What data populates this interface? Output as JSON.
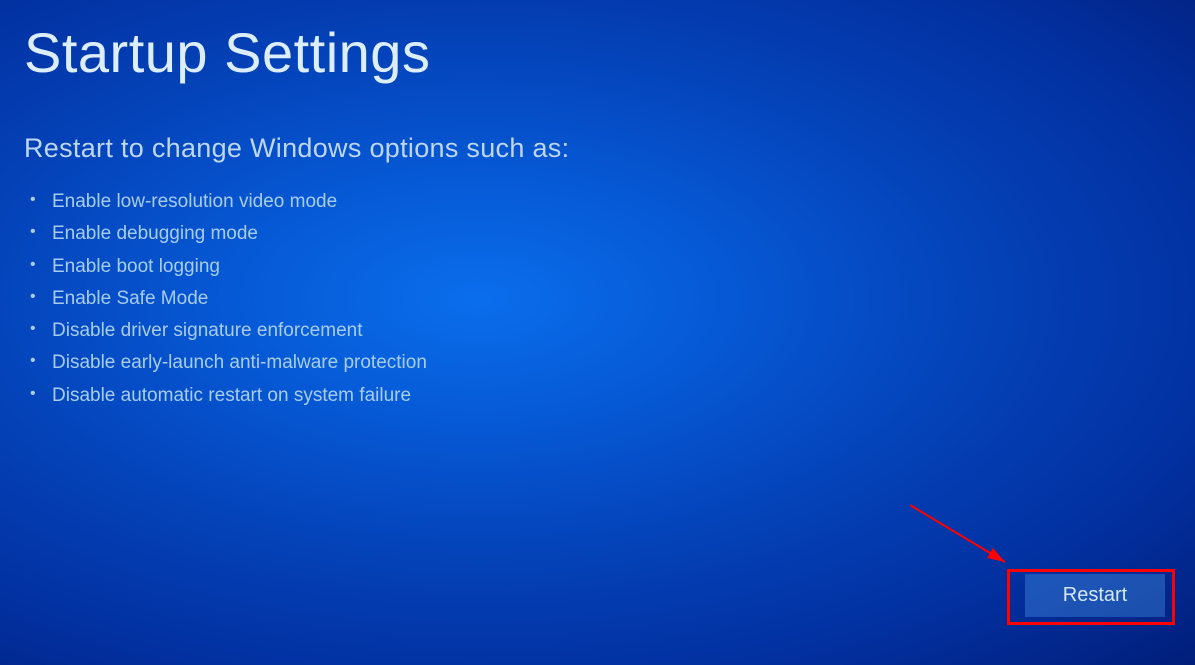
{
  "title": "Startup Settings",
  "subtitle": "Restart to change Windows options such as:",
  "options": [
    "Enable low-resolution video mode",
    "Enable debugging mode",
    "Enable boot logging",
    "Enable Safe Mode",
    "Disable driver signature enforcement",
    "Disable early-launch anti-malware protection",
    "Disable automatic restart on system failure"
  ],
  "restart_button": "Restart"
}
